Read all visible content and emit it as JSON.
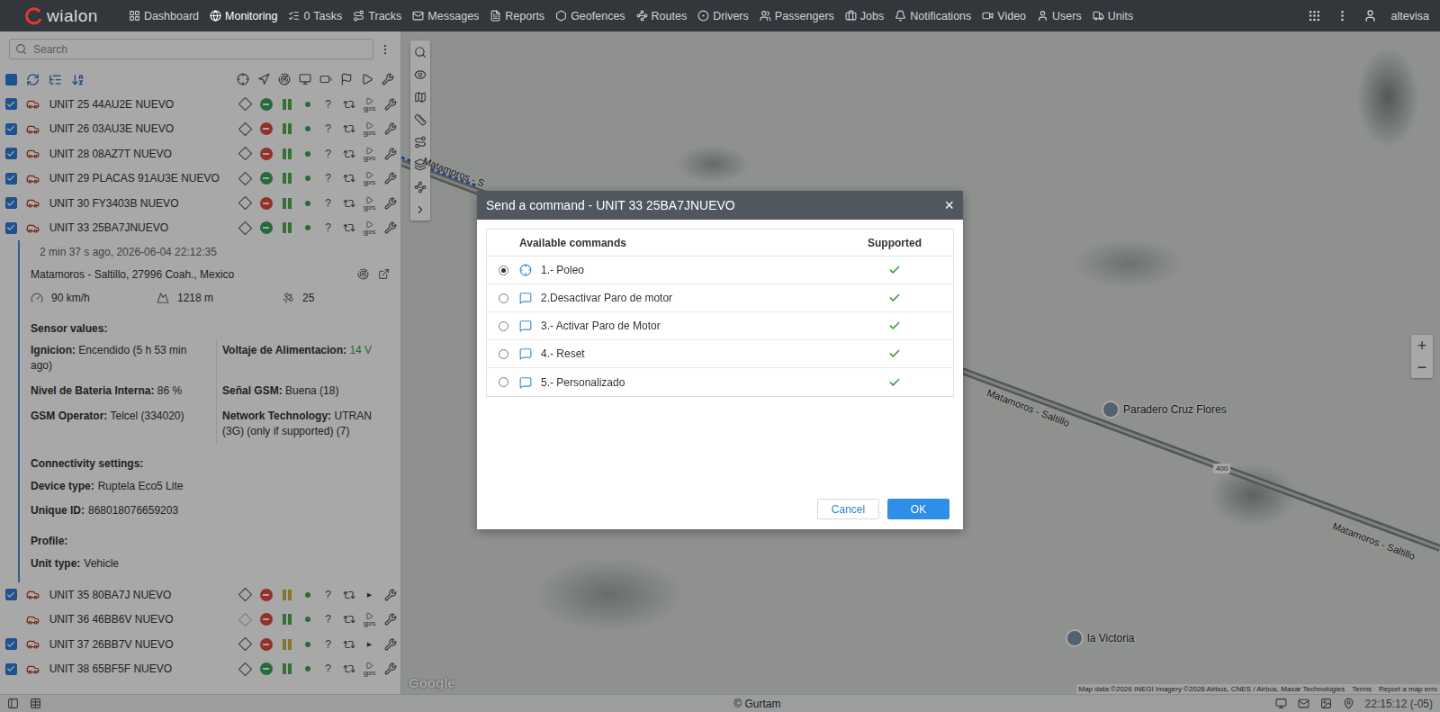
{
  "topbar": {
    "logo": "wialon",
    "user": "altevisa",
    "nav": [
      {
        "label": "Dashboard",
        "selected": false,
        "badge": ""
      },
      {
        "label": "Monitoring",
        "selected": true,
        "badge": ""
      },
      {
        "label": "Tasks",
        "selected": false,
        "badge": "0"
      },
      {
        "label": "Tracks",
        "selected": false,
        "badge": ""
      },
      {
        "label": "Messages",
        "selected": false,
        "badge": ""
      },
      {
        "label": "Reports",
        "selected": false,
        "badge": ""
      },
      {
        "label": "Geofences",
        "selected": false,
        "badge": ""
      },
      {
        "label": "Routes",
        "selected": false,
        "badge": ""
      },
      {
        "label": "Drivers",
        "selected": false,
        "badge": ""
      },
      {
        "label": "Passengers",
        "selected": false,
        "badge": ""
      },
      {
        "label": "Jobs",
        "selected": false,
        "badge": ""
      },
      {
        "label": "Notifications",
        "selected": false,
        "badge": ""
      },
      {
        "label": "Video",
        "selected": false,
        "badge": ""
      },
      {
        "label": "Users",
        "selected": false,
        "badge": ""
      },
      {
        "label": "Units",
        "selected": false,
        "badge": ""
      }
    ]
  },
  "search": {
    "placeholder": "Search"
  },
  "units": [
    {
      "name": "UNIT 25 44AU2E NUEVO",
      "checked": true,
      "located": true,
      "moving": true,
      "signal_color": "#4caf50",
      "help": "?",
      "command": "gprs",
      "expanded": false
    },
    {
      "name": "UNIT 26 03AU3E NUEVO",
      "checked": true,
      "located": true,
      "moving": false,
      "signal_color": "#4caf50",
      "help": "?",
      "command": "gprs",
      "expanded": false
    },
    {
      "name": "UNIT 28 08AZ7T NUEVO",
      "checked": true,
      "located": true,
      "moving": false,
      "signal_color": "#4caf50",
      "help": "?",
      "command": "gprs",
      "expanded": false
    },
    {
      "name": "UNIT 29 PLACAS 91AU3E NUEVO",
      "checked": true,
      "located": true,
      "moving": true,
      "signal_color": "#4caf50",
      "help": "?",
      "command": "gprs",
      "expanded": false
    },
    {
      "name": "UNIT 30 FY3403B NUEVO",
      "checked": true,
      "located": true,
      "moving": false,
      "signal_color": "#4caf50",
      "help": "?",
      "command": "gprs",
      "expanded": false
    },
    {
      "name": "UNIT 33 25BA7JNUEVO",
      "checked": true,
      "located": true,
      "moving": true,
      "signal_color": "#4caf50",
      "help": "?",
      "command": "gprs",
      "expanded": true
    },
    {
      "name": "UNIT 35 80BA7J NUEVO",
      "checked": true,
      "located": true,
      "moving": false,
      "signal_color": "#c9b447",
      "help": "?",
      "command": "▶",
      "expanded": false
    },
    {
      "name": "UNIT 36 46BB6V NUEVO",
      "checked": false,
      "located": false,
      "moving": false,
      "signal_color": "#4caf50",
      "help": "?",
      "command": "gprs",
      "expanded": false
    },
    {
      "name": "UNIT 37 26BB7V NUEVO",
      "checked": true,
      "located": true,
      "moving": false,
      "signal_color": "#c9b447",
      "help": "?",
      "command": "▶",
      "expanded": false
    },
    {
      "name": "UNIT 38 65BF5F NUEVO",
      "checked": true,
      "located": true,
      "moving": true,
      "signal_color": "#4caf50",
      "help": "?",
      "command": "gprs",
      "expanded": false
    }
  ],
  "details": {
    "time": "2 min 37 s ago, 2026-06-04 22:12:35",
    "address": "Matamoros - Saltillo, 27996 Coah., Mexico",
    "speed": "90 km/h",
    "altitude": "1218 m",
    "satellites": "25",
    "sections": [
      {
        "title": "Sensor values:",
        "kind": "grid",
        "fields": [
          {
            "label": "Ignicion:",
            "value": "Encendido (5 h 53 min ago)",
            "color": "#333333"
          },
          {
            "label": "Voltaje de Alimentacion:",
            "value": "14 V",
            "color": "#3aa35a"
          },
          {
            "label": "Nivel de Bateria Interna:",
            "value": "86 %",
            "color": "#333333"
          },
          {
            "label": "Señal GSM:",
            "value": "Buena (18)",
            "color": "#333333"
          },
          {
            "label": "GSM Operator:",
            "value": "Telcel (334020)",
            "color": "#333333"
          },
          {
            "label": "Network Technology:",
            "value": "UTRAN (3G) (only if supported) (7)",
            "color": "#333333"
          }
        ]
      },
      {
        "title": "Connectivity settings:",
        "kind": "list",
        "fields": [
          {
            "label": "Device type:",
            "value": "Ruptela Eco5 Lite",
            "color": "#333333"
          },
          {
            "label": "Unique ID:",
            "value": "868018076659203",
            "color": "#333333"
          }
        ]
      },
      {
        "title": "Profile:",
        "kind": "list",
        "fields": [
          {
            "label": "Unit type:",
            "value": "Vehicle",
            "color": "#333333"
          }
        ]
      }
    ]
  },
  "map": {
    "road_labels": [
      "Matamoros - S",
      "Matamoros - Saltillo",
      "Matamoros - Saltillo"
    ],
    "shield": "400",
    "pins": [
      "Paradero Cruz Flores",
      "la Victoria"
    ],
    "zoom": [
      "+",
      "−"
    ],
    "logo": "Google",
    "attribution": [
      "Map data ©2026 INEGI Imagery ©2026 Airbus, CNES / Airbus, Maxar Technologies",
      "Terms",
      "Report a map erro"
    ]
  },
  "dialog": {
    "title": "Send a command - UNIT 33 25BA7JNUEVO",
    "close": "×",
    "columns": [
      "Available commands",
      "Supported"
    ],
    "commands": [
      {
        "label": "1.- Poleo",
        "kind": "poll",
        "selected": true,
        "supported": true
      },
      {
        "label": "2.Desactivar Paro de motor",
        "kind": "message",
        "selected": false,
        "supported": true
      },
      {
        "label": "3.- Activar Paro de Motor",
        "kind": "message",
        "selected": false,
        "supported": true
      },
      {
        "label": "4.- Reset",
        "kind": "message",
        "selected": false,
        "supported": true
      },
      {
        "label": "5.- Personalizado",
        "kind": "message",
        "selected": false,
        "supported": true
      }
    ],
    "buttons": [
      {
        "label": "Cancel",
        "primary": false
      },
      {
        "label": "OK",
        "primary": true
      }
    ]
  },
  "status_bar": {
    "copyright": "© Gurtam",
    "time": "22:15:12 (-05)"
  }
}
